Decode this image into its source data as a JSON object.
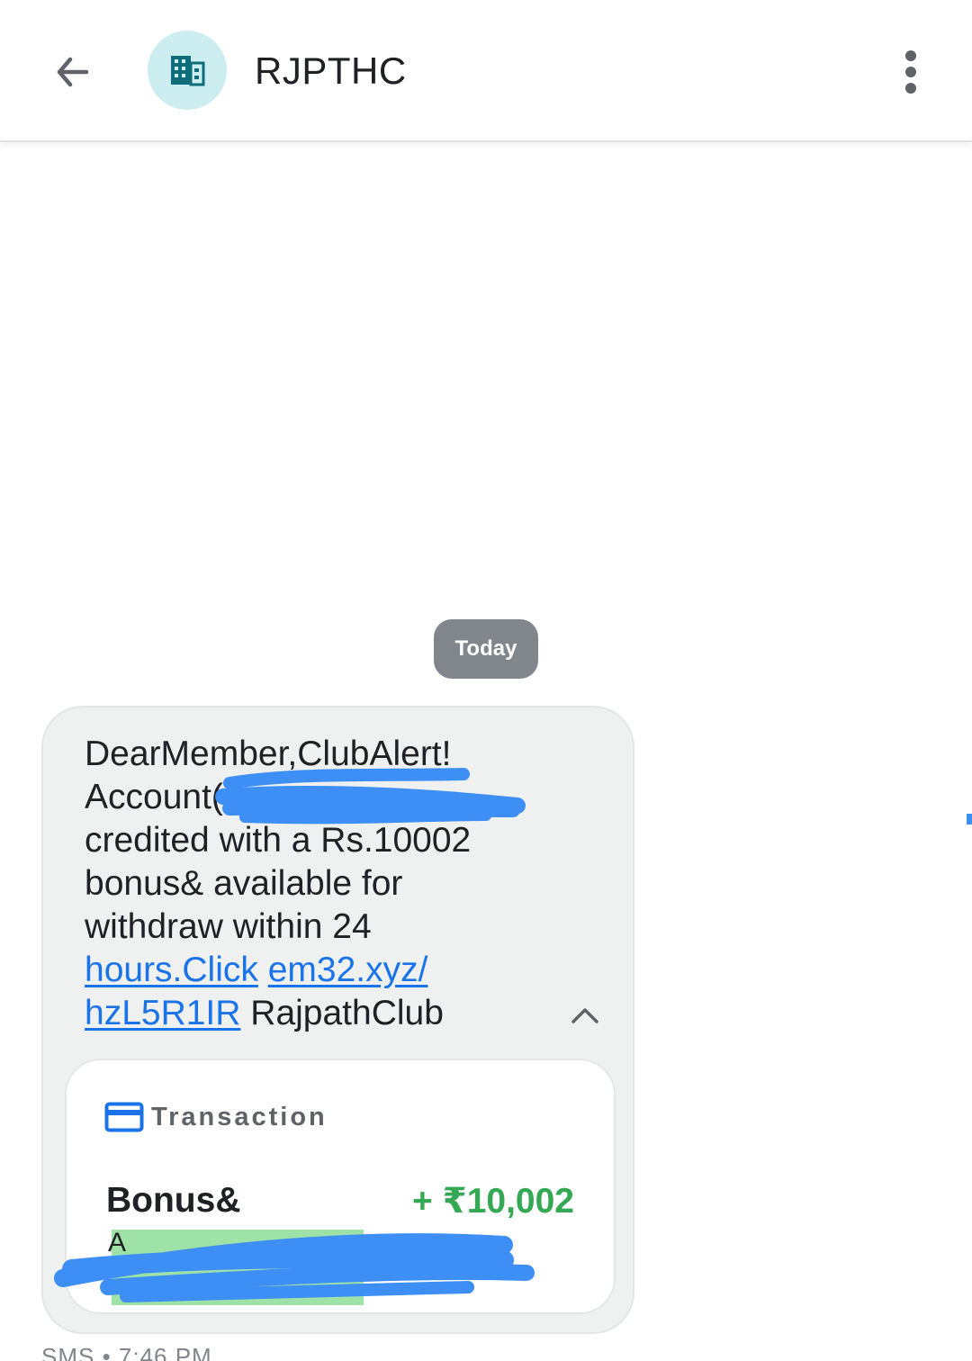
{
  "header": {
    "title": "RJPTHC",
    "back_icon": "arrow-back-icon",
    "avatar_icon": "business-building-icon",
    "more_icon": "more-vertical-icon"
  },
  "date_chip": "Today",
  "message": {
    "line1": "DearMember,ClubAlert!",
    "line2": "Account(",
    "line3": "credited with a Rs.10002",
    "line4": "bonus& available for",
    "line5": "withdraw within 24",
    "link1": "hours.Click",
    "link2": "em32.xyz/",
    "link3": "hzL5R1IR",
    "tail": "RajpathClub"
  },
  "transaction": {
    "title": "Transaction",
    "label": "Bonus&",
    "sub_label": "A",
    "amount": "+ ₹10,002",
    "icon": "credit-card-icon"
  },
  "timestamp": "SMS • 7:46 PM",
  "colors": {
    "accent_link": "#1a73e8",
    "amount_green": "#34a853",
    "avatar_bg": "#cdeef1",
    "avatar_icon": "#0f6e79",
    "chip_bg": "#80868b",
    "redaction": "#3d8ef5"
  }
}
